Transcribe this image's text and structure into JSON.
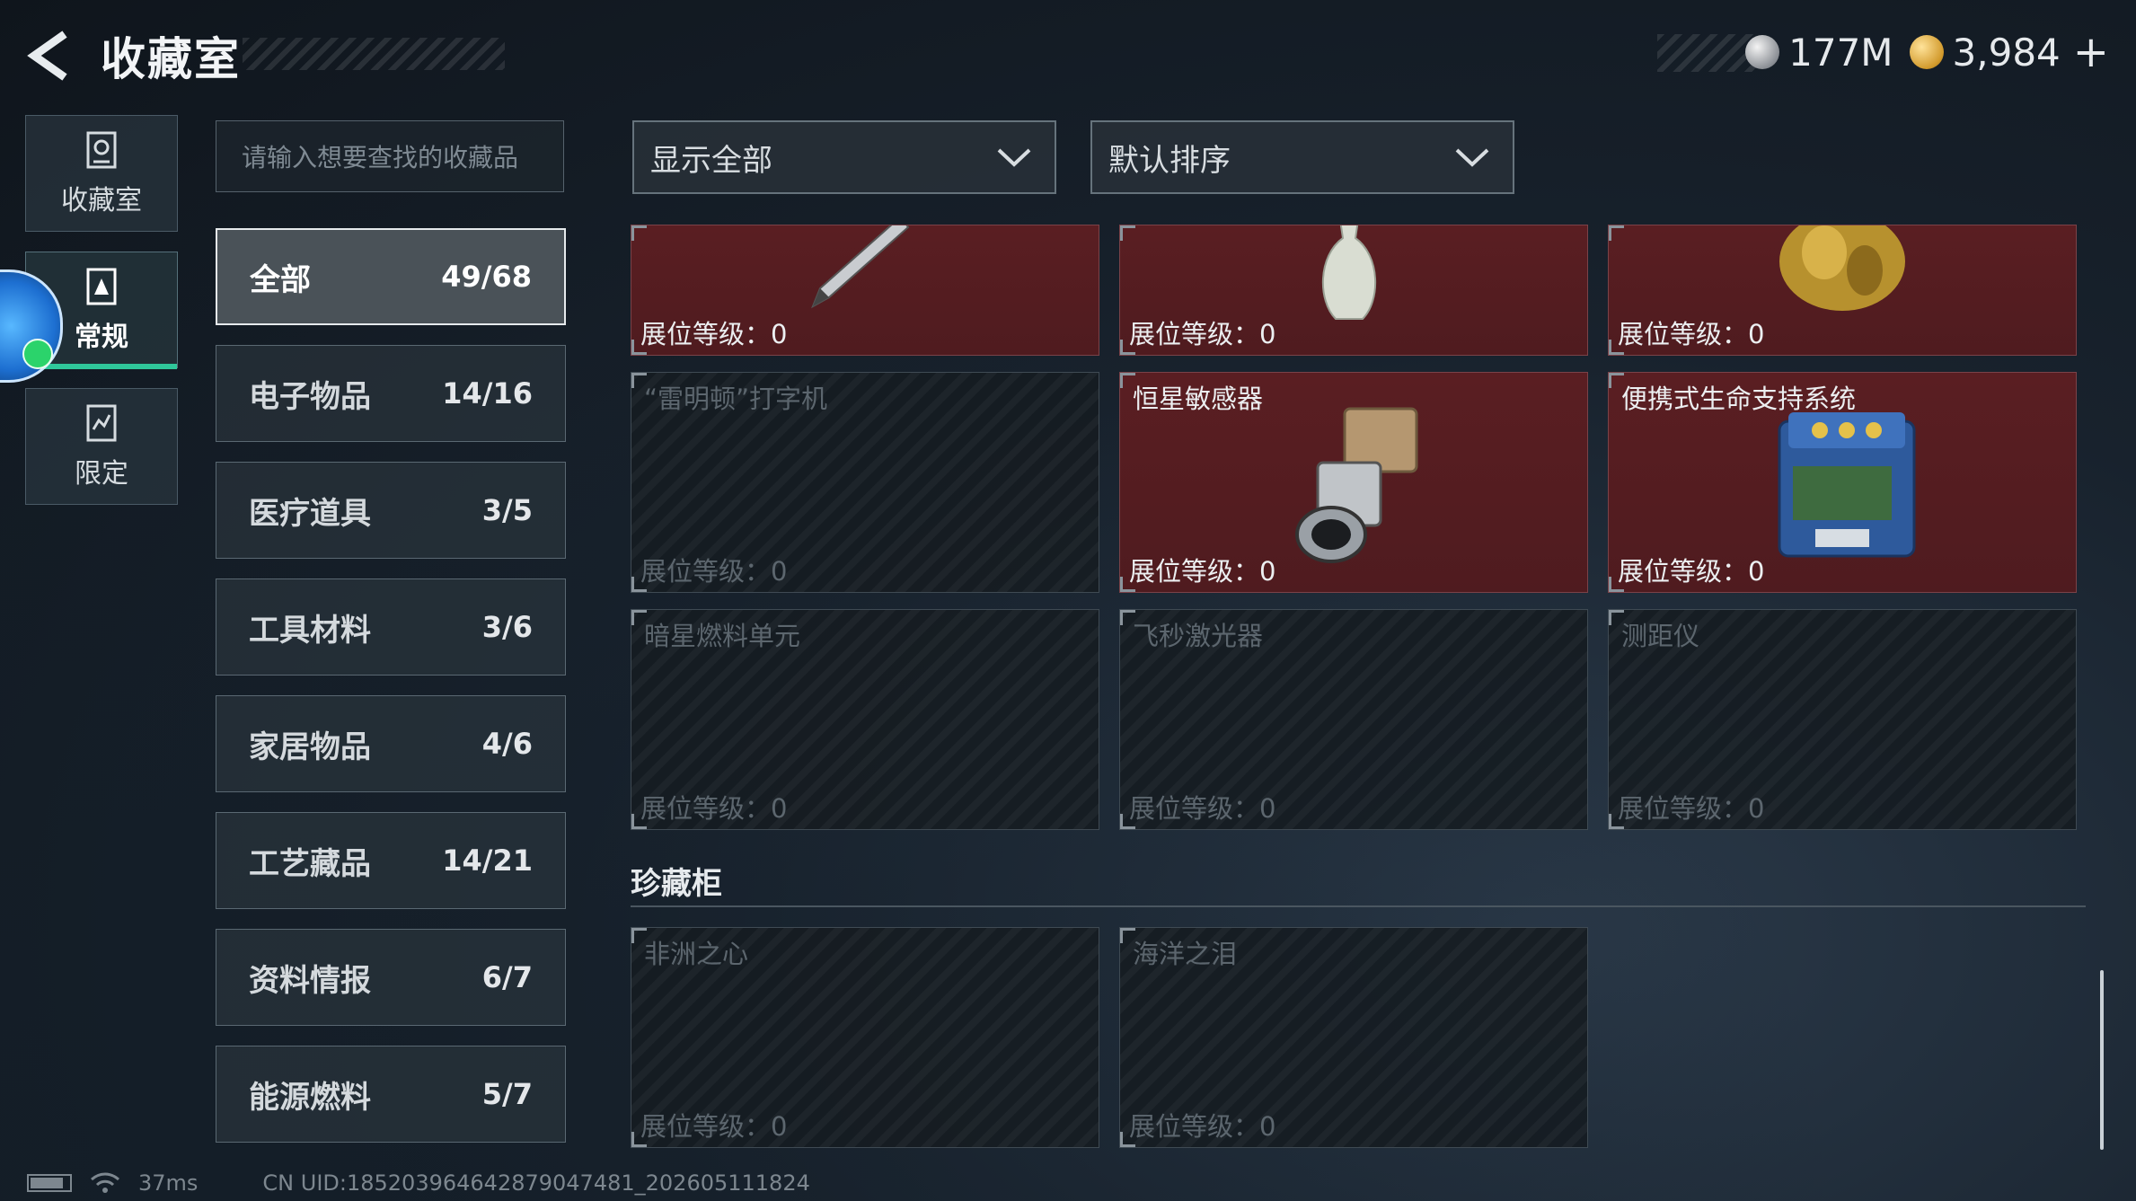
{
  "header": {
    "title": "收藏室",
    "currency": [
      {
        "icon": "silver-coin-icon",
        "value": "177M"
      },
      {
        "icon": "gold-coin-icon",
        "value": "3,984"
      }
    ],
    "plus_label": "+"
  },
  "left_nav": {
    "items": [
      {
        "label": "收藏室",
        "icon": "collection-room-icon"
      },
      {
        "label": "常规",
        "icon": "regular-icon",
        "active": true
      },
      {
        "label": "限定",
        "icon": "limited-icon"
      }
    ]
  },
  "search": {
    "placeholder": "请输入想要查找的收藏品"
  },
  "categories": [
    {
      "name": "全部",
      "count": "49/68",
      "active": true
    },
    {
      "name": "电子物品",
      "count": "14/16"
    },
    {
      "name": "医疗道具",
      "count": "3/5"
    },
    {
      "name": "工具材料",
      "count": "3/6"
    },
    {
      "name": "家居物品",
      "count": "4/6"
    },
    {
      "name": "工艺藏品",
      "count": "14/21"
    },
    {
      "name": "资料情报",
      "count": "6/7"
    },
    {
      "name": "能源燃料",
      "count": "5/7"
    }
  ],
  "filters": {
    "show": "显示全部",
    "sort": "默认排序"
  },
  "level_label": "展位等级：0",
  "items": [
    {
      "name": "",
      "level": "展位等级：0",
      "owned": true,
      "icon": "pen-icon"
    },
    {
      "name": "",
      "level": "展位等级：0",
      "owned": true,
      "icon": "vase-icon"
    },
    {
      "name": "",
      "level": "展位等级：0",
      "owned": true,
      "icon": "golden-statue-icon"
    },
    {
      "name": "“雷明顿”打字机",
      "level": "展位等级：0",
      "owned": false
    },
    {
      "name": "恒星敏感器",
      "level": "展位等级：0",
      "owned": true,
      "icon": "star-sensor-icon"
    },
    {
      "name": "便携式生命支持系统",
      "level": "展位等级：0",
      "owned": true,
      "icon": "life-support-icon"
    },
    {
      "name": "暗星燃料单元",
      "level": "展位等级：0",
      "owned": false
    },
    {
      "name": "飞秒激光器",
      "level": "展位等级：0",
      "owned": false
    },
    {
      "name": "测距仪",
      "level": "展位等级：0",
      "owned": false
    }
  ],
  "cabinet": {
    "title": "珍藏柜",
    "items": [
      {
        "name": "非洲之心",
        "level": "展位等级：0",
        "owned": false
      },
      {
        "name": "海洋之泪",
        "level": "展位等级：0",
        "owned": false
      }
    ]
  },
  "status": {
    "ping": "37ms",
    "uid": "CN UID:18520396464287904748‌1_202605111824"
  },
  "colors": {
    "owned_card": "#5a1e22",
    "active_accent": "#2fc79a",
    "locked_card": "#161c22"
  }
}
